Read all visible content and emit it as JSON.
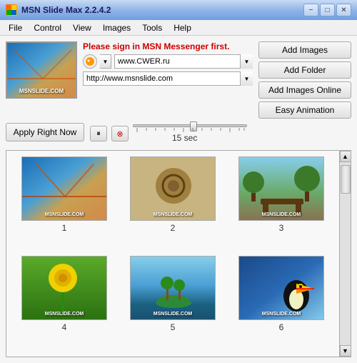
{
  "titlebar": {
    "title": "MSN Slide Max  2.2.4.2",
    "min_btn": "−",
    "max_btn": "□",
    "close_btn": "✕"
  },
  "menu": {
    "items": [
      "File",
      "Control",
      "View",
      "Images",
      "Tools",
      "Help"
    ]
  },
  "header": {
    "sign_in_text": "Please sign in MSN Messenger first.",
    "url1": "www.CWER.ru",
    "url2": "http://www.msnslide.com"
  },
  "buttons": {
    "add_images": "Add Images",
    "add_folder": "Add Folder",
    "add_images_online": "Add Images Online",
    "easy_animation": "Easy Animation",
    "apply_right_now": "Apply Right Now"
  },
  "playback": {
    "pause_icon": "⏸",
    "stop_icon": "⊗",
    "time": "15 sec"
  },
  "watermark": "MSNSLIDE.COM",
  "images": [
    {
      "id": 1,
      "label": "1"
    },
    {
      "id": 2,
      "label": "2"
    },
    {
      "id": 3,
      "label": "3"
    },
    {
      "id": 4,
      "label": "4"
    },
    {
      "id": 5,
      "label": "5"
    },
    {
      "id": 6,
      "label": "6"
    }
  ]
}
